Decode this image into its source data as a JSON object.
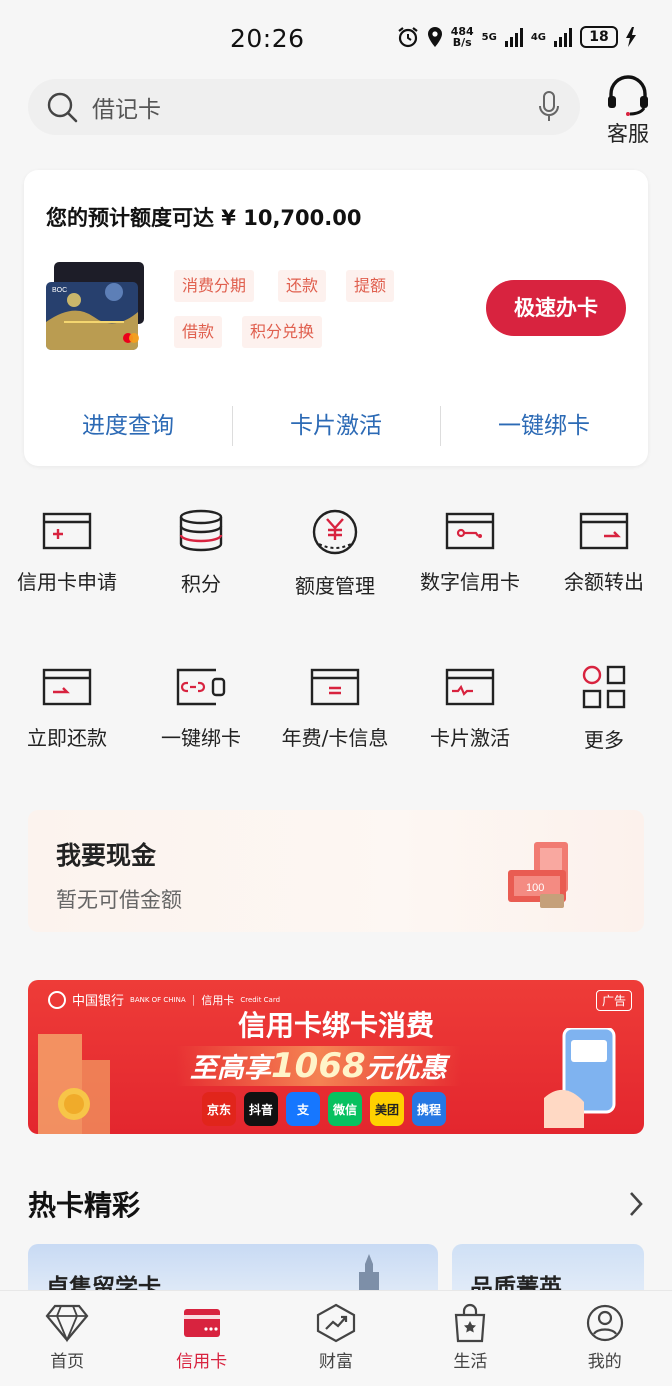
{
  "status_bar": {
    "time": "20:26",
    "speed_top": "484",
    "speed_bottom": "B/s",
    "net1": "5G",
    "net2": "4G",
    "battery": "18"
  },
  "search": {
    "placeholder": "借记卡",
    "service_label": "客服"
  },
  "quota_card": {
    "title": "您的预计额度可达 ¥ 10,700.00",
    "tags": [
      "消费分期",
      "还款",
      "提额",
      "借款",
      "积分兑换"
    ],
    "apply_label": "极速办卡",
    "links": [
      "进度查询",
      "卡片激活",
      "一键绑卡"
    ]
  },
  "grid": [
    {
      "label": "信用卡申请",
      "icon": "card-plus-icon"
    },
    {
      "label": "积分",
      "icon": "coins-stack-icon"
    },
    {
      "label": "额度管理",
      "icon": "yuan-gauge-icon"
    },
    {
      "label": "数字信用卡",
      "icon": "digital-card-icon"
    },
    {
      "label": "余额转出",
      "icon": "card-transfer-icon"
    },
    {
      "label": "立即还款",
      "icon": "card-repay-icon"
    },
    {
      "label": "一键绑卡",
      "icon": "card-link-icon"
    },
    {
      "label": "年费/卡信息",
      "icon": "card-info-icon"
    },
    {
      "label": "卡片激活",
      "icon": "card-activate-icon"
    },
    {
      "label": "更多",
      "icon": "more-grid-icon"
    }
  ],
  "cash": {
    "title": "我要现金",
    "subtitle": "暂无可借金额"
  },
  "ad": {
    "tag": "广告",
    "brand": "中国银行",
    "brand_en": "BANK OF CHINA",
    "brand_product": "信用卡",
    "brand_product_en": "Credit Card",
    "headline": "信用卡绑卡消费",
    "sub_prefix": "至高享",
    "sub_number": "1068",
    "sub_suffix": "元优惠",
    "apps": [
      "京东",
      "抖音",
      "支",
      "微信",
      "美团",
      "携程"
    ]
  },
  "hot": {
    "title": "热卡精彩",
    "cards": [
      "卓隽留学卡",
      "品质菁英"
    ]
  },
  "tabs": [
    {
      "label": "首页",
      "icon": "diamond-icon"
    },
    {
      "label": "信用卡",
      "icon": "credit-card-icon"
    },
    {
      "label": "财富",
      "icon": "wealth-chart-icon"
    },
    {
      "label": "生活",
      "icon": "shopping-bag-icon"
    },
    {
      "label": "我的",
      "icon": "user-icon"
    }
  ],
  "colors": {
    "brand_red": "#d8233f",
    "link_blue": "#2c6ab5",
    "tag_text": "#e0604f",
    "tag_bg": "#fdf1ee"
  }
}
